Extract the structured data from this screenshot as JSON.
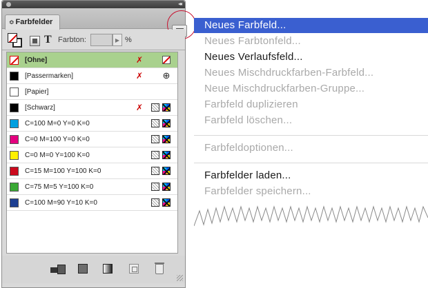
{
  "panel": {
    "tab_title": "Farbfelder",
    "tab_arrows": "≎",
    "toolbar": {
      "tint_label": "Farbton:",
      "tint_value": "",
      "tint_unit": "%"
    },
    "swatches": [
      {
        "label": "[Ohne]",
        "color": "none",
        "selected": true,
        "icons": [
          "pencil-icon",
          "none-swatch-icon"
        ]
      },
      {
        "label": "[Passermarken]",
        "color": "#000000",
        "icons": [
          "pencil-icon",
          "registration-icon"
        ]
      },
      {
        "label": "[Papier]",
        "color": "#ffffff",
        "icons": []
      },
      {
        "label": "[Schwarz]",
        "color": "#000000",
        "icons": [
          "pencil-icon",
          "process-color-icon",
          "cmyk-icon"
        ]
      },
      {
        "label": "C=100 M=0 Y=0 K=0",
        "color": "#00a0e0",
        "icons": [
          "process-color-icon",
          "cmyk-icon"
        ]
      },
      {
        "label": "C=0 M=100 Y=0 K=0",
        "color": "#e4007f",
        "icons": [
          "process-color-icon",
          "cmyk-icon"
        ]
      },
      {
        "label": "C=0 M=0 Y=100 K=0",
        "color": "#fff100",
        "icons": [
          "process-color-icon",
          "cmyk-icon"
        ]
      },
      {
        "label": "C=15 M=100 Y=100 K=0",
        "color": "#cc0a1e",
        "icons": [
          "process-color-icon",
          "cmyk-icon"
        ]
      },
      {
        "label": "C=75 M=5 Y=100 K=0",
        "color": "#3aa935",
        "icons": [
          "process-color-icon",
          "cmyk-icon"
        ]
      },
      {
        "label": "C=100 M=90 Y=10 K=0",
        "color": "#1d3f91",
        "icons": [
          "process-color-icon",
          "cmyk-icon"
        ]
      }
    ]
  },
  "menu": {
    "items": [
      {
        "label": "Neues Farbfeld...",
        "state": "highlight"
      },
      {
        "label": "Neues Farbtonfeld...",
        "state": "disabled"
      },
      {
        "label": "Neues Verlaufsfeld...",
        "state": "enabled"
      },
      {
        "label": "Neues Mischdruckfarben-Farbfeld...",
        "state": "disabled"
      },
      {
        "label": "Neue Mischdruckfarben-Gruppe...",
        "state": "disabled"
      },
      {
        "label": "Farbfeld duplizieren",
        "state": "disabled"
      },
      {
        "label": "Farbfeld löschen...",
        "state": "disabled"
      },
      {
        "label": "Farbfeldoptionen...",
        "state": "disabled"
      },
      {
        "label": "Farbfelder laden...",
        "state": "enabled"
      },
      {
        "label": "Farbfelder speichern...",
        "state": "disabled"
      }
    ],
    "highlight_color": "#3a5fd0",
    "disabled_color": "#a9a9a9"
  }
}
